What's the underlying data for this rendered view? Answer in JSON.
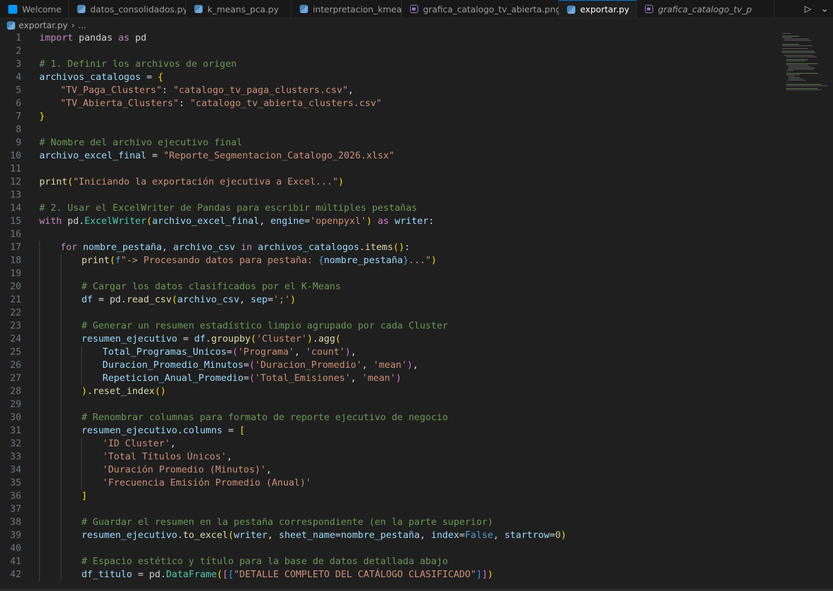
{
  "tabs": [
    {
      "label": "Welcome",
      "icon": "vscode-icon",
      "active": false,
      "italic": false
    },
    {
      "label": "datos_consolidados.py",
      "icon": "python-icon",
      "active": false,
      "italic": false
    },
    {
      "label": "k_means_pca.py",
      "icon": "python-icon",
      "active": false,
      "italic": false
    },
    {
      "label": "interpretacion_kmeans",
      "icon": "python-icon",
      "active": false,
      "italic": false
    },
    {
      "label": "grafica_catalogo_tv_abierta.png",
      "icon": "image-icon",
      "active": false,
      "italic": false
    },
    {
      "label": "exportar.py",
      "icon": "python-icon",
      "active": true,
      "italic": false,
      "close": "×"
    },
    {
      "label": "grafica_catalogo_tv_p",
      "icon": "image-icon",
      "active": false,
      "italic": true
    }
  ],
  "tab_actions": {
    "run": "▷",
    "dropdown": "⌄"
  },
  "breadcrumb": {
    "file": "exportar.py",
    "separator": "›",
    "rest": "..."
  },
  "editor": {
    "lines": [
      {
        "n": "1",
        "indent": 0,
        "tokens": [
          [
            "kw",
            "import"
          ],
          [
            "txt",
            " pandas "
          ],
          [
            "kw",
            "as"
          ],
          [
            "txt",
            " pd"
          ]
        ]
      },
      {
        "n": "2",
        "indent": 0,
        "tokens": []
      },
      {
        "n": "3",
        "indent": 0,
        "tokens": [
          [
            "cmt",
            "# 1. Definir los archivos de origen"
          ]
        ]
      },
      {
        "n": "4",
        "indent": 0,
        "tokens": [
          [
            "var",
            "archivos_catalogos"
          ],
          [
            "op",
            " = "
          ],
          [
            "br1",
            "{"
          ]
        ]
      },
      {
        "n": "5",
        "indent": 1,
        "tokens": [
          [
            "str",
            "\"TV_Paga_Clusters\""
          ],
          [
            "op",
            ": "
          ],
          [
            "str",
            "\"catalogo_tv_paga_clusters.csv\""
          ],
          [
            "op",
            ","
          ]
        ]
      },
      {
        "n": "6",
        "indent": 1,
        "tokens": [
          [
            "str",
            "\"TV_Abierta_Clusters\""
          ],
          [
            "op",
            ": "
          ],
          [
            "str",
            "\"catalogo_tv_abierta_clusters.csv\""
          ]
        ]
      },
      {
        "n": "7",
        "indent": 0,
        "tokens": [
          [
            "br1",
            "}"
          ]
        ]
      },
      {
        "n": "8",
        "indent": 0,
        "tokens": []
      },
      {
        "n": "9",
        "indent": 0,
        "tokens": [
          [
            "cmt",
            "# Nombre del archivo ejecutivo final"
          ]
        ]
      },
      {
        "n": "10",
        "indent": 0,
        "tokens": [
          [
            "var",
            "archivo_excel_final"
          ],
          [
            "op",
            " = "
          ],
          [
            "str",
            "\"Reporte_Segmentacion_Catalogo_2026.xlsx\""
          ]
        ]
      },
      {
        "n": "11",
        "indent": 0,
        "tokens": []
      },
      {
        "n": "12",
        "indent": 0,
        "tokens": [
          [
            "fn",
            "print"
          ],
          [
            "br1",
            "("
          ],
          [
            "str",
            "\"Iniciando la exportación ejecutiva a Excel...\""
          ],
          [
            "br1",
            ")"
          ]
        ]
      },
      {
        "n": "13",
        "indent": 0,
        "tokens": []
      },
      {
        "n": "14",
        "indent": 0,
        "tokens": [
          [
            "cmt",
            "# 2. Usar el ExcelWriter de Pandas para escribir múltiples pestañas"
          ]
        ]
      },
      {
        "n": "15",
        "indent": 0,
        "tokens": [
          [
            "kw",
            "with"
          ],
          [
            "txt",
            " pd."
          ],
          [
            "cls",
            "ExcelWriter"
          ],
          [
            "br1",
            "("
          ],
          [
            "var",
            "archivo_excel_final"
          ],
          [
            "op",
            ", "
          ],
          [
            "var",
            "engine"
          ],
          [
            "op",
            "="
          ],
          [
            "str",
            "'openpyxl'"
          ],
          [
            "br1",
            ")"
          ],
          [
            "txt",
            " "
          ],
          [
            "kw",
            "as"
          ],
          [
            "txt",
            " "
          ],
          [
            "var",
            "writer"
          ],
          [
            "op",
            ":"
          ]
        ]
      },
      {
        "n": "16",
        "indent": 0,
        "tokens": []
      },
      {
        "n": "17",
        "indent": 1,
        "tokens": [
          [
            "kw",
            "for"
          ],
          [
            "txt",
            " "
          ],
          [
            "var",
            "nombre_pestaña"
          ],
          [
            "op",
            ", "
          ],
          [
            "var",
            "archivo_csv"
          ],
          [
            "txt",
            " "
          ],
          [
            "kw",
            "in"
          ],
          [
            "txt",
            " "
          ],
          [
            "var",
            "archivos_catalogos"
          ],
          [
            "op",
            "."
          ],
          [
            "fn",
            "items"
          ],
          [
            "br1",
            "()"
          ],
          [
            "op",
            ":"
          ]
        ]
      },
      {
        "n": "18",
        "indent": 2,
        "tokens": [
          [
            "fn",
            "print"
          ],
          [
            "br1",
            "("
          ],
          [
            "kb",
            "f"
          ],
          [
            "str",
            "\"-> Procesando datos para pestaña: "
          ],
          [
            "kb",
            "{"
          ],
          [
            "var",
            "nombre_pestaña"
          ],
          [
            "kb",
            "}"
          ],
          [
            "str",
            "...\""
          ],
          [
            "br1",
            ")"
          ]
        ]
      },
      {
        "n": "19",
        "indent": 0,
        "tokens": []
      },
      {
        "n": "20",
        "indent": 2,
        "tokens": [
          [
            "cmt",
            "# Cargar los datos clasificados por el K-Means"
          ]
        ]
      },
      {
        "n": "21",
        "indent": 2,
        "tokens": [
          [
            "var",
            "df"
          ],
          [
            "op",
            " = "
          ],
          [
            "txt",
            "pd."
          ],
          [
            "fn",
            "read_csv"
          ],
          [
            "br1",
            "("
          ],
          [
            "var",
            "archivo_csv"
          ],
          [
            "op",
            ", "
          ],
          [
            "var",
            "sep"
          ],
          [
            "op",
            "="
          ],
          [
            "str",
            "';'"
          ],
          [
            "br1",
            ")"
          ]
        ]
      },
      {
        "n": "22",
        "indent": 0,
        "tokens": []
      },
      {
        "n": "23",
        "indent": 2,
        "tokens": [
          [
            "cmt",
            "# Generar un resumen estadístico limpio agrupado por cada Cluster"
          ]
        ]
      },
      {
        "n": "24",
        "indent": 2,
        "tokens": [
          [
            "var",
            "resumen_ejecutivo"
          ],
          [
            "op",
            " = "
          ],
          [
            "var",
            "df"
          ],
          [
            "op",
            "."
          ],
          [
            "fn",
            "groupby"
          ],
          [
            "br1",
            "("
          ],
          [
            "str",
            "'Cluster'"
          ],
          [
            "br1",
            ")"
          ],
          [
            "op",
            "."
          ],
          [
            "fn",
            "agg"
          ],
          [
            "br1",
            "("
          ]
        ]
      },
      {
        "n": "25",
        "indent": 3,
        "tokens": [
          [
            "var",
            "Total_Programas_Unicos"
          ],
          [
            "op",
            "="
          ],
          [
            "br2",
            "("
          ],
          [
            "str",
            "'Programa'"
          ],
          [
            "op",
            ", "
          ],
          [
            "str",
            "'count'"
          ],
          [
            "br2",
            ")"
          ],
          [
            "op",
            ","
          ]
        ]
      },
      {
        "n": "26",
        "indent": 3,
        "tokens": [
          [
            "var",
            "Duracion_Promedio_Minutos"
          ],
          [
            "op",
            "="
          ],
          [
            "br2",
            "("
          ],
          [
            "str",
            "'Duracion_Promedio'"
          ],
          [
            "op",
            ", "
          ],
          [
            "str",
            "'mean'"
          ],
          [
            "br2",
            ")"
          ],
          [
            "op",
            ","
          ]
        ]
      },
      {
        "n": "27",
        "indent": 3,
        "tokens": [
          [
            "var",
            "Repeticion_Anual_Promedio"
          ],
          [
            "op",
            "="
          ],
          [
            "br2",
            "("
          ],
          [
            "str",
            "'Total_Emisiones'"
          ],
          [
            "op",
            ", "
          ],
          [
            "str",
            "'mean'"
          ],
          [
            "br2",
            ")"
          ]
        ]
      },
      {
        "n": "28",
        "indent": 2,
        "tokens": [
          [
            "br1",
            ")"
          ],
          [
            "op",
            "."
          ],
          [
            "fn",
            "reset_index"
          ],
          [
            "br1",
            "()"
          ]
        ]
      },
      {
        "n": "29",
        "indent": 0,
        "tokens": []
      },
      {
        "n": "30",
        "indent": 2,
        "tokens": [
          [
            "cmt",
            "# Renombrar columnas para formato de reporte ejecutivo de negocio"
          ]
        ]
      },
      {
        "n": "31",
        "indent": 2,
        "tokens": [
          [
            "var",
            "resumen_ejecutivo"
          ],
          [
            "op",
            "."
          ],
          [
            "var",
            "columns"
          ],
          [
            "op",
            " = "
          ],
          [
            "br1",
            "["
          ]
        ]
      },
      {
        "n": "32",
        "indent": 3,
        "tokens": [
          [
            "str",
            "'ID Cluster'"
          ],
          [
            "op",
            ","
          ]
        ]
      },
      {
        "n": "33",
        "indent": 3,
        "tokens": [
          [
            "str",
            "'Total Títulos Únicos'"
          ],
          [
            "op",
            ","
          ]
        ]
      },
      {
        "n": "34",
        "indent": 3,
        "tokens": [
          [
            "str",
            "'Duración Promedio (Minutos)'"
          ],
          [
            "op",
            ","
          ]
        ]
      },
      {
        "n": "35",
        "indent": 3,
        "tokens": [
          [
            "str",
            "'Frecuencia Emisión Promedio (Anual)'"
          ]
        ]
      },
      {
        "n": "36",
        "indent": 2,
        "tokens": [
          [
            "br1",
            "]"
          ]
        ]
      },
      {
        "n": "37",
        "indent": 0,
        "tokens": []
      },
      {
        "n": "38",
        "indent": 2,
        "tokens": [
          [
            "cmt",
            "# Guardar el resumen en la pestaña correspondiente (en la parte superior)"
          ]
        ]
      },
      {
        "n": "39",
        "indent": 2,
        "tokens": [
          [
            "var",
            "resumen_ejecutivo"
          ],
          [
            "op",
            "."
          ],
          [
            "fn",
            "to_excel"
          ],
          [
            "br1",
            "("
          ],
          [
            "var",
            "writer"
          ],
          [
            "op",
            ", "
          ],
          [
            "var",
            "sheet_name"
          ],
          [
            "op",
            "="
          ],
          [
            "var",
            "nombre_pestaña"
          ],
          [
            "op",
            ", "
          ],
          [
            "var",
            "index"
          ],
          [
            "op",
            "="
          ],
          [
            "kb",
            "False"
          ],
          [
            "op",
            ", "
          ],
          [
            "var",
            "startrow"
          ],
          [
            "op",
            "="
          ],
          [
            "num",
            "0"
          ],
          [
            "br1",
            ")"
          ]
        ]
      },
      {
        "n": "40",
        "indent": 0,
        "tokens": []
      },
      {
        "n": "41",
        "indent": 2,
        "tokens": [
          [
            "cmt",
            "# Espacio estético y título para la base de datos detallada abajo"
          ]
        ]
      },
      {
        "n": "42",
        "indent": 2,
        "tokens": [
          [
            "var",
            "df_titulo"
          ],
          [
            "op",
            " = "
          ],
          [
            "txt",
            "pd."
          ],
          [
            "cls",
            "DataFrame"
          ],
          [
            "br1",
            "("
          ],
          [
            "br2",
            "["
          ],
          [
            "br3",
            "["
          ],
          [
            "str",
            "\"DETALLE COMPLETO DEL CATÁLOGO CLASIFICADO\""
          ],
          [
            "br3",
            "]"
          ],
          [
            "br2",
            "]"
          ],
          [
            "br1",
            ")"
          ]
        ]
      }
    ]
  }
}
